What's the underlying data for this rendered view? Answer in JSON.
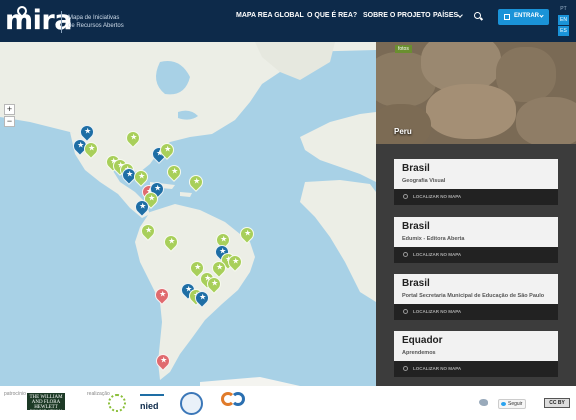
{
  "header": {
    "logo": "mira",
    "tagline_line1": "Mapa de Iniciativas",
    "tagline_line2": "de Recursos Abertos",
    "nav": {
      "global_map": "MAPA REA GLOBAL",
      "what_is": "O QUE É REA?",
      "about": "SOBRE O PROJETO",
      "countries": "PAÍSES"
    },
    "enter_label": "ENTRAR",
    "languages": [
      "PT",
      "EN",
      "ES"
    ]
  },
  "map": {
    "zoom_in": "+",
    "zoom_out": "−",
    "pin_colors": {
      "green": "#a8cf5a",
      "blue": "#1e6ea5",
      "red": "#e06a6e"
    }
  },
  "panel": {
    "photo_tag": "fotos",
    "photo_title": "Peru",
    "locate_label": "LOCALIZAR NO MAPA",
    "cards": [
      {
        "country": "Brasil",
        "name": "Geografia Visual"
      },
      {
        "country": "Brasil",
        "name": "Edumix - Editora Aberta"
      },
      {
        "country": "Brasil",
        "name": "Portal Secretaria Municipal de Educação de São Paulo"
      },
      {
        "country": "Equador",
        "name": "Aprendemos"
      }
    ]
  },
  "footer": {
    "sponsor_label": "patrocínio",
    "sponsor_logo_text": "THE WILLIAM AND FLORA HEWLETT FOUNDATION",
    "realization_label": "realização",
    "partner_logo_nied": "nied",
    "follow_label": "Seguir",
    "license_label": "CC BY"
  }
}
